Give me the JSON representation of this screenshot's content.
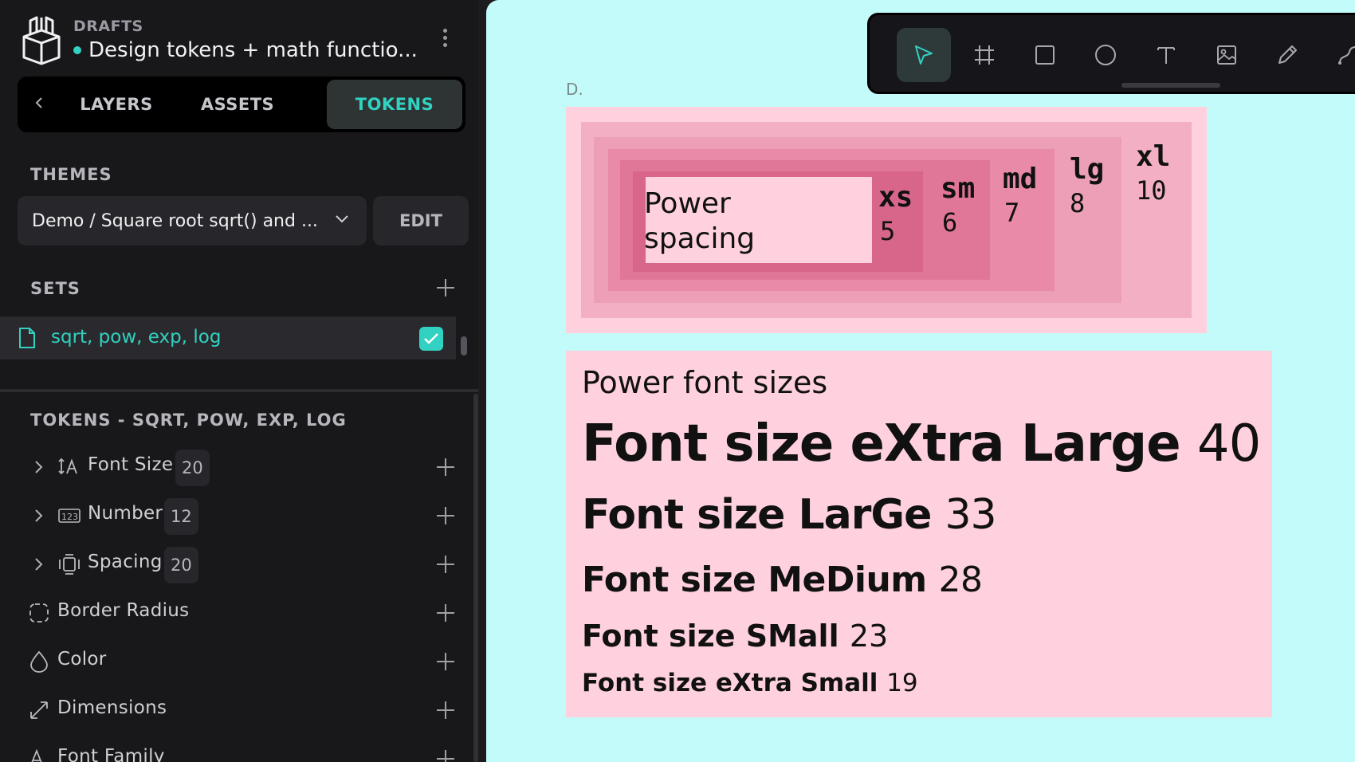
{
  "header": {
    "project_label": "DRAFTS",
    "project_title": "Design tokens + math functio..."
  },
  "tabs": [
    {
      "label": "LAYERS"
    },
    {
      "label": "ASSETS"
    },
    {
      "label": "TOKENS",
      "active": true
    }
  ],
  "themes": {
    "section_title": "THEMES",
    "selected": "Demo / Square root sqrt() and ...",
    "edit_label": "EDIT"
  },
  "sets": {
    "section_title": "SETS",
    "items": [
      {
        "name": "sqrt, pow, exp, log",
        "checked": true
      }
    ]
  },
  "tokens": {
    "section_title": "TOKENS - SQRT, POW, EXP, LOG",
    "items": [
      {
        "label": "Font Size",
        "count": "20",
        "icon": "font-size-icon",
        "expandable": true
      },
      {
        "label": "Number",
        "count": "12",
        "icon": "number-icon",
        "expandable": true
      },
      {
        "label": "Spacing",
        "count": "20",
        "icon": "spacing-icon",
        "expandable": true
      },
      {
        "label": "Border Radius",
        "icon": "border-radius-icon"
      },
      {
        "label": "Color",
        "icon": "color-drop-icon"
      },
      {
        "label": "Dimensions",
        "icon": "dimensions-icon"
      },
      {
        "label": "Font Family",
        "icon": "font-family-icon"
      }
    ]
  },
  "toolbar": {
    "tools": [
      "move-tool",
      "board-tool",
      "rectangle-tool",
      "ellipse-tool",
      "text-tool",
      "image-tool",
      "pencil-tool",
      "path-tool"
    ],
    "active": "move-tool"
  },
  "canvas": {
    "background": "#c2fbfa",
    "frame_label": "D.",
    "spacing": {
      "title_line1": "Power",
      "title_line2": "spacing",
      "steps": [
        {
          "name": "xs",
          "value": "5"
        },
        {
          "name": "sm",
          "value": "6"
        },
        {
          "name": "md",
          "value": "7"
        },
        {
          "name": "lg",
          "value": "8"
        },
        {
          "name": "xl",
          "value": "10"
        }
      ]
    },
    "fonts": {
      "title": "Power font sizes",
      "samples": [
        {
          "label": "Font size eXtra Large",
          "value": "40"
        },
        {
          "label": "Font size LarGe",
          "value": "33"
        },
        {
          "label": "Font size MeDium",
          "value": "28"
        },
        {
          "label": "Font size SMall",
          "value": "23"
        },
        {
          "label": "Font size eXtra Small",
          "value": "19"
        }
      ]
    }
  },
  "colors": {
    "accent": "#31d2c2",
    "sidebar_bg": "#18181b",
    "canvas_bg": "#c2fbfa",
    "pink_1": "#ffd1de",
    "pink_2": "#f3afc4",
    "pink_3": "#ec9fb7",
    "pink_4": "#e88aa8",
    "pink_5": "#e07798",
    "pink_6": "#d8668b"
  }
}
